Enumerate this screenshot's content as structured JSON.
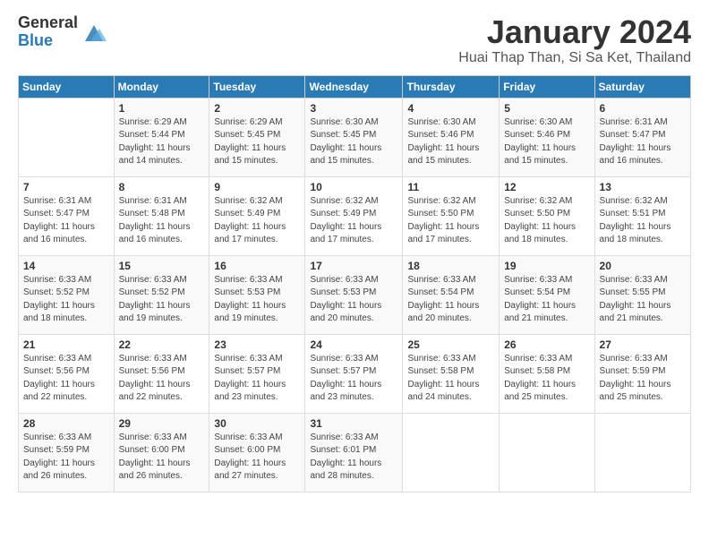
{
  "logo": {
    "general": "General",
    "blue": "Blue"
  },
  "header": {
    "title": "January 2024",
    "location": "Huai Thap Than, Si Sa Ket, Thailand"
  },
  "days_of_week": [
    "Sunday",
    "Monday",
    "Tuesday",
    "Wednesday",
    "Thursday",
    "Friday",
    "Saturday"
  ],
  "weeks": [
    [
      {
        "num": "",
        "info": ""
      },
      {
        "num": "1",
        "info": "Sunrise: 6:29 AM\nSunset: 5:44 PM\nDaylight: 11 hours\nand 14 minutes."
      },
      {
        "num": "2",
        "info": "Sunrise: 6:29 AM\nSunset: 5:45 PM\nDaylight: 11 hours\nand 15 minutes."
      },
      {
        "num": "3",
        "info": "Sunrise: 6:30 AM\nSunset: 5:45 PM\nDaylight: 11 hours\nand 15 minutes."
      },
      {
        "num": "4",
        "info": "Sunrise: 6:30 AM\nSunset: 5:46 PM\nDaylight: 11 hours\nand 15 minutes."
      },
      {
        "num": "5",
        "info": "Sunrise: 6:30 AM\nSunset: 5:46 PM\nDaylight: 11 hours\nand 15 minutes."
      },
      {
        "num": "6",
        "info": "Sunrise: 6:31 AM\nSunset: 5:47 PM\nDaylight: 11 hours\nand 16 minutes."
      }
    ],
    [
      {
        "num": "7",
        "info": "Sunrise: 6:31 AM\nSunset: 5:47 PM\nDaylight: 11 hours\nand 16 minutes."
      },
      {
        "num": "8",
        "info": "Sunrise: 6:31 AM\nSunset: 5:48 PM\nDaylight: 11 hours\nand 16 minutes."
      },
      {
        "num": "9",
        "info": "Sunrise: 6:32 AM\nSunset: 5:49 PM\nDaylight: 11 hours\nand 17 minutes."
      },
      {
        "num": "10",
        "info": "Sunrise: 6:32 AM\nSunset: 5:49 PM\nDaylight: 11 hours\nand 17 minutes."
      },
      {
        "num": "11",
        "info": "Sunrise: 6:32 AM\nSunset: 5:50 PM\nDaylight: 11 hours\nand 17 minutes."
      },
      {
        "num": "12",
        "info": "Sunrise: 6:32 AM\nSunset: 5:50 PM\nDaylight: 11 hours\nand 18 minutes."
      },
      {
        "num": "13",
        "info": "Sunrise: 6:32 AM\nSunset: 5:51 PM\nDaylight: 11 hours\nand 18 minutes."
      }
    ],
    [
      {
        "num": "14",
        "info": "Sunrise: 6:33 AM\nSunset: 5:52 PM\nDaylight: 11 hours\nand 18 minutes."
      },
      {
        "num": "15",
        "info": "Sunrise: 6:33 AM\nSunset: 5:52 PM\nDaylight: 11 hours\nand 19 minutes."
      },
      {
        "num": "16",
        "info": "Sunrise: 6:33 AM\nSunset: 5:53 PM\nDaylight: 11 hours\nand 19 minutes."
      },
      {
        "num": "17",
        "info": "Sunrise: 6:33 AM\nSunset: 5:53 PM\nDaylight: 11 hours\nand 20 minutes."
      },
      {
        "num": "18",
        "info": "Sunrise: 6:33 AM\nSunset: 5:54 PM\nDaylight: 11 hours\nand 20 minutes."
      },
      {
        "num": "19",
        "info": "Sunrise: 6:33 AM\nSunset: 5:54 PM\nDaylight: 11 hours\nand 21 minutes."
      },
      {
        "num": "20",
        "info": "Sunrise: 6:33 AM\nSunset: 5:55 PM\nDaylight: 11 hours\nand 21 minutes."
      }
    ],
    [
      {
        "num": "21",
        "info": "Sunrise: 6:33 AM\nSunset: 5:56 PM\nDaylight: 11 hours\nand 22 minutes."
      },
      {
        "num": "22",
        "info": "Sunrise: 6:33 AM\nSunset: 5:56 PM\nDaylight: 11 hours\nand 22 minutes."
      },
      {
        "num": "23",
        "info": "Sunrise: 6:33 AM\nSunset: 5:57 PM\nDaylight: 11 hours\nand 23 minutes."
      },
      {
        "num": "24",
        "info": "Sunrise: 6:33 AM\nSunset: 5:57 PM\nDaylight: 11 hours\nand 23 minutes."
      },
      {
        "num": "25",
        "info": "Sunrise: 6:33 AM\nSunset: 5:58 PM\nDaylight: 11 hours\nand 24 minutes."
      },
      {
        "num": "26",
        "info": "Sunrise: 6:33 AM\nSunset: 5:58 PM\nDaylight: 11 hours\nand 25 minutes."
      },
      {
        "num": "27",
        "info": "Sunrise: 6:33 AM\nSunset: 5:59 PM\nDaylight: 11 hours\nand 25 minutes."
      }
    ],
    [
      {
        "num": "28",
        "info": "Sunrise: 6:33 AM\nSunset: 5:59 PM\nDaylight: 11 hours\nand 26 minutes."
      },
      {
        "num": "29",
        "info": "Sunrise: 6:33 AM\nSunset: 6:00 PM\nDaylight: 11 hours\nand 26 minutes."
      },
      {
        "num": "30",
        "info": "Sunrise: 6:33 AM\nSunset: 6:00 PM\nDaylight: 11 hours\nand 27 minutes."
      },
      {
        "num": "31",
        "info": "Sunrise: 6:33 AM\nSunset: 6:01 PM\nDaylight: 11 hours\nand 28 minutes."
      },
      {
        "num": "",
        "info": ""
      },
      {
        "num": "",
        "info": ""
      },
      {
        "num": "",
        "info": ""
      }
    ]
  ]
}
